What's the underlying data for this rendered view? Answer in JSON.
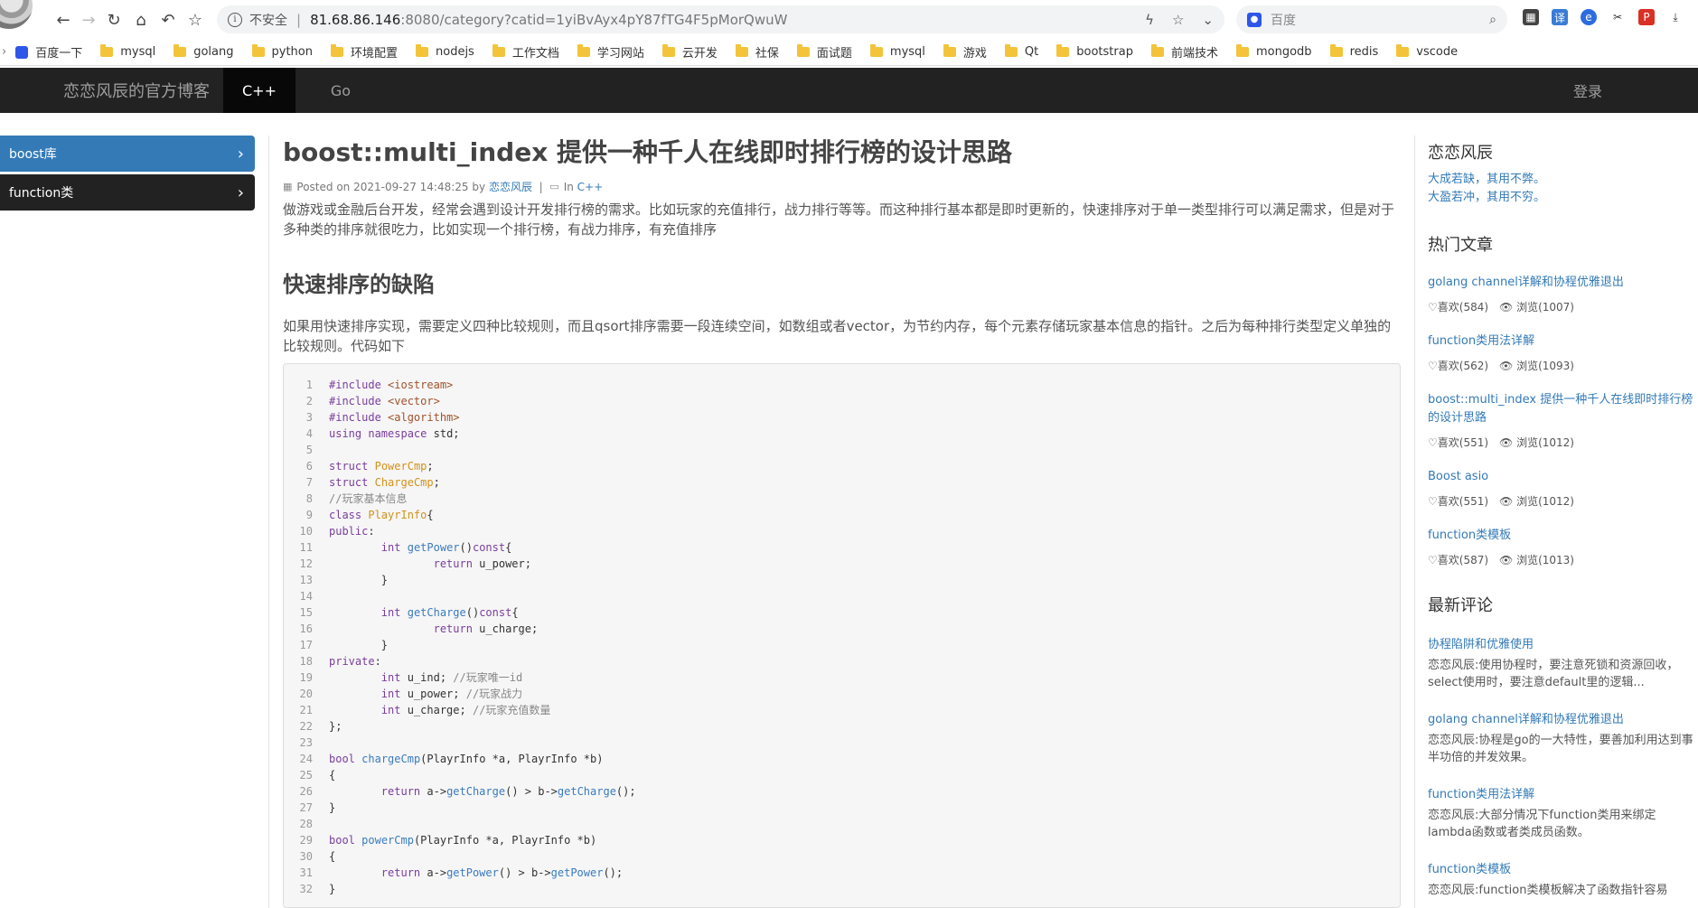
{
  "browser": {
    "insecure_label": "不安全",
    "separator": "|",
    "url_host": "81.68.86.146",
    "url_path": ":8080/category?catid=1yiBvAyx4pY87fTG4F5pMorQwuW",
    "search_placeholder": "百度",
    "info_glyph": "i"
  },
  "bookmarks": [
    "百度一下",
    "mysql",
    "golang",
    "python",
    "环境配置",
    "nodejs",
    "工作文档",
    "学习网站",
    "云开发",
    "社保",
    "面试题",
    "mysql",
    "游戏",
    "Qt",
    "bootstrap",
    "前端技术",
    "mongodb",
    "redis",
    "vscode"
  ],
  "header": {
    "brand": "恋恋风辰的官方博客",
    "nav": [
      "C++",
      "Go"
    ],
    "login": "登录"
  },
  "left_menu": [
    {
      "label": "boost库",
      "active": true
    },
    {
      "label": "function类",
      "active": false
    }
  ],
  "article": {
    "title": "boost::multi_index 提供一种千人在线即时排行榜的设计思路",
    "posted_prefix": "Posted on",
    "posted_date": "2021-09-27 14:48:25",
    "by_label": "by",
    "author": "恋恋风辰",
    "meta_sep": "|",
    "in_label": "In",
    "category": "C++",
    "intro": "做游戏或金融后台开发，经常会遇到设计开发排行榜的需求。比如玩家的充值排行，战力排行等等。而这种排行基本都是即时更新的，快速排序对于单一类型排行可以满足需求，但是对于多种类的排序就很吃力，比如实现一个排行榜，有战力排序，有充值排序",
    "h2": "快速排序的缺陷",
    "para2": "如果用快速排序实现，需要定义四种比较规则，而且qsort排序需要一段连续空间，如数组或者vector，为节约内存，每个元素存储玩家基本信息的指针。之后为每种排行类型定义单独的比较规则。代码如下",
    "code_lines": [
      "#include <iostream>",
      "#include <vector>",
      "#include <algorithm>",
      "using namespace std;",
      "",
      "struct PowerCmp;",
      "struct ChargeCmp;",
      "//玩家基本信息",
      "class PlayrInfo{",
      "public:",
      "        int getPower()const{",
      "                return u_power;",
      "        }",
      "",
      "        int getCharge()const{",
      "                return u_charge;",
      "        }",
      "private:",
      "        int u_ind; //玩家唯一id",
      "        int u_power; //玩家战力",
      "        int u_charge; //玩家充值数量",
      "};",
      "",
      "bool chargeCmp(PlayrInfo *a, PlayrInfo *b)",
      "{",
      "        return a->getCharge() > b->getCharge();",
      "}",
      "",
      "bool powerCmp(PlayrInfo *a, PlayrInfo *b)",
      "{",
      "        return a->getPower() > b->getPower();",
      "}"
    ]
  },
  "sidebar": {
    "author_heading": "恋恋风辰",
    "quote1": "大成若缺，其用不弊。",
    "quote2": "大盈若冲，其用不穷。",
    "hot_heading": "热门文章",
    "hot": [
      {
        "title": "golang channel详解和协程优雅退出",
        "likes": "♡喜欢(584)",
        "views": "👁 浏览(1007)"
      },
      {
        "title": "function类用法详解",
        "likes": "♡喜欢(562)",
        "views": "👁 浏览(1093)"
      },
      {
        "title": "boost::multi_index 提供一种千人在线即时排行榜的设计思路",
        "likes": "♡喜欢(551)",
        "views": "👁 浏览(1012)"
      },
      {
        "title": "Boost asio",
        "likes": "♡喜欢(551)",
        "views": "👁 浏览(1012)"
      },
      {
        "title": "function类模板",
        "likes": "♡喜欢(587)",
        "views": "👁 浏览(1013)"
      }
    ],
    "comments_heading": "最新评论",
    "comments": [
      {
        "title": "协程陷阱和优雅使用",
        "text": "恋恋风辰:使用协程时，要注意死锁和资源回收，select使用时，要注意default里的逻辑..."
      },
      {
        "title": "golang channel详解和协程优雅退出",
        "text": "恋恋风辰:协程是go的一大特性，要善加利用达到事半功倍的并发效果。"
      },
      {
        "title": "function类用法详解",
        "text": "恋恋风辰:大部分情况下function类用来绑定lambda函数或者类成员函数。"
      },
      {
        "title": "function类模板",
        "text": "恋恋风辰:function类模板解决了函数指针容易"
      }
    ]
  },
  "colors": {
    "nav_bg": "#222222",
    "accent": "#337ab7"
  }
}
